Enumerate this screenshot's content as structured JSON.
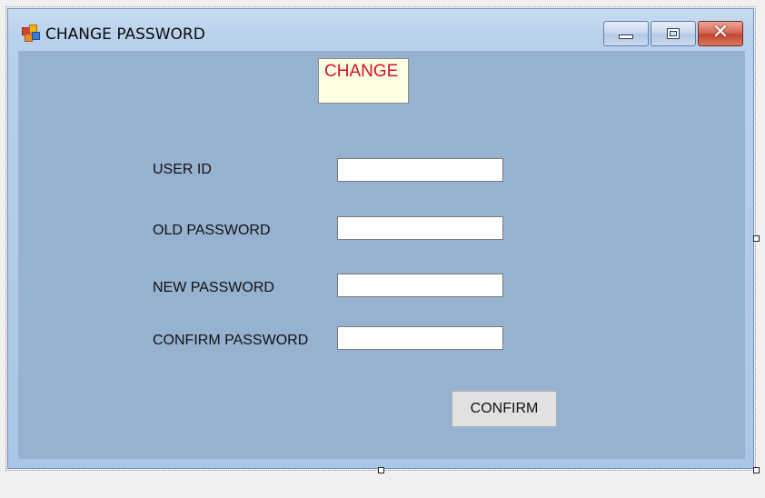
{
  "window": {
    "title": "CHANGE PASSWORD",
    "icon": "windows-form-icon",
    "controls": {
      "minimize_icon": "minimize-icon",
      "maximize_icon": "maximize-icon",
      "close_glyph": "✕"
    }
  },
  "form": {
    "badge_text": "CHANGE",
    "fields": [
      {
        "label": "USER ID",
        "value": ""
      },
      {
        "label": "OLD PASSWORD",
        "value": ""
      },
      {
        "label": "NEW PASSWORD",
        "value": ""
      },
      {
        "label": "CONFIRM PASSWORD",
        "value": ""
      }
    ],
    "confirm_label": "CONFIRM"
  },
  "colors": {
    "client_background": "#97b2d1",
    "badge_background": "#ffffe1",
    "badge_text": "#d0122c",
    "close_button": "#c24630"
  }
}
